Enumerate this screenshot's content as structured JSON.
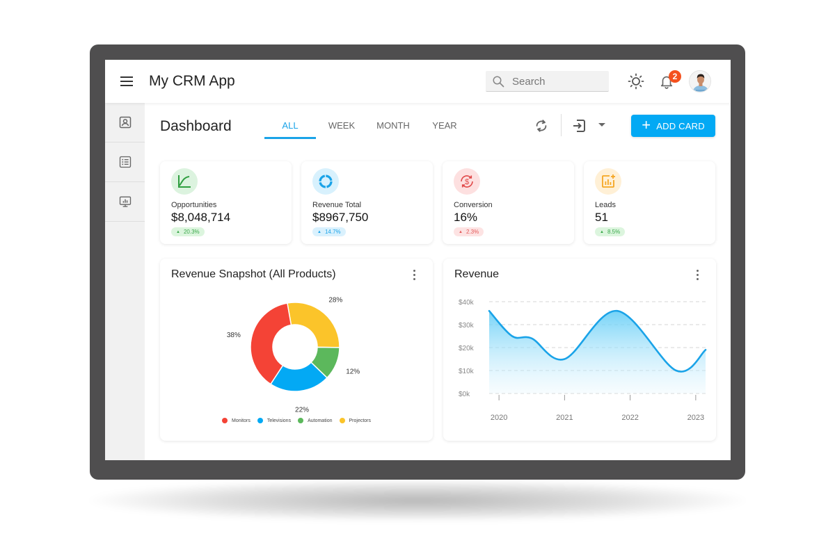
{
  "app": {
    "title": "My CRM App",
    "search_placeholder": "Search",
    "notifications_count": "2",
    "icons": {
      "menu": "menu-icon",
      "search": "search-icon",
      "theme": "sun-icon",
      "notifications": "bell-icon",
      "avatar": "user-avatar"
    }
  },
  "sidebar": {
    "items": [
      {
        "name": "contacts",
        "icon": "contact-card-icon"
      },
      {
        "name": "lists",
        "icon": "list-icon"
      },
      {
        "name": "reports",
        "icon": "presentation-chart-icon"
      }
    ]
  },
  "header": {
    "title": "Dashboard",
    "tabs": [
      {
        "label": "ALL",
        "active": true
      },
      {
        "label": "WEEK",
        "active": false
      },
      {
        "label": "MONTH",
        "active": false
      },
      {
        "label": "YEAR",
        "active": false
      }
    ],
    "add_card_label": "ADD CARD",
    "icons": {
      "refresh": "refresh-icon",
      "export": "export-icon",
      "dropdown": "caret-down-icon"
    }
  },
  "kpis": [
    {
      "label": "Opportunities",
      "value": "$8,048,714",
      "change": "20.3%",
      "icon": "trend-chart-icon",
      "color": "#2e9e3f",
      "bg": "#dcf3df",
      "chip_bg": "#dcf5de",
      "chip_color": "#3aa84a"
    },
    {
      "label": "Revenue Total",
      "value": "$8967,750",
      "change": "14.7%",
      "icon": "donut-icon",
      "color": "#1aa3e8",
      "bg": "#d8f1fd",
      "chip_bg": "#daf1fd",
      "chip_color": "#1aa3e8"
    },
    {
      "label": "Conversion",
      "value": "16%",
      "change": "2.3%",
      "icon": "dollar-cycle-icon",
      "color": "#e04848",
      "bg": "#fde0e0",
      "chip_bg": "#fde3e3",
      "chip_color": "#e45a5a"
    },
    {
      "label": "Leads",
      "value": "51",
      "change": "8.5%",
      "icon": "add-chart-icon",
      "color": "#f5a623",
      "bg": "#fff0d6",
      "chip_bg": "#dcf5de",
      "chip_color": "#3aa84a"
    }
  ],
  "chart_data": [
    {
      "type": "pie",
      "title": "Revenue Snapshot (All Products)",
      "donut": true,
      "categories": [
        "Projectors",
        "Automation",
        "Televisions",
        "Monitors"
      ],
      "values": [
        28,
        12,
        22,
        38
      ],
      "labels": [
        "28%",
        "12%",
        "22%",
        "38%"
      ],
      "colors": [
        "#fbc42a",
        "#5cb85c",
        "#03a9f4",
        "#f44336"
      ],
      "legend": {
        "position": "bottom",
        "entries": [
          {
            "label": "Monitors",
            "color": "#f44336"
          },
          {
            "label": "Televisions",
            "color": "#03a9f4"
          },
          {
            "label": "Automation",
            "color": "#5cb85c"
          },
          {
            "label": "Projectors",
            "color": "#fbc42a"
          }
        ]
      }
    },
    {
      "type": "area",
      "title": "Revenue",
      "x": [
        2019.85,
        2020.2,
        2020.5,
        2021.0,
        2021.8,
        2022.7,
        2023.15
      ],
      "y": [
        36000,
        25000,
        24000,
        15000,
        36000,
        10000,
        19000
      ],
      "xticks": [
        "2020",
        "2021",
        "2022",
        "2023"
      ],
      "xtick_values": [
        2020,
        2021,
        2022,
        2023
      ],
      "yticks": [
        "$0k",
        "$10k",
        "$20k",
        "$30k",
        "$40k"
      ],
      "ytick_values": [
        0,
        10000,
        20000,
        30000,
        40000
      ],
      "ylim": [
        0,
        40000
      ],
      "xlim": [
        2019.85,
        2023.15
      ],
      "grid": true,
      "color": "#1aa3e8"
    }
  ]
}
